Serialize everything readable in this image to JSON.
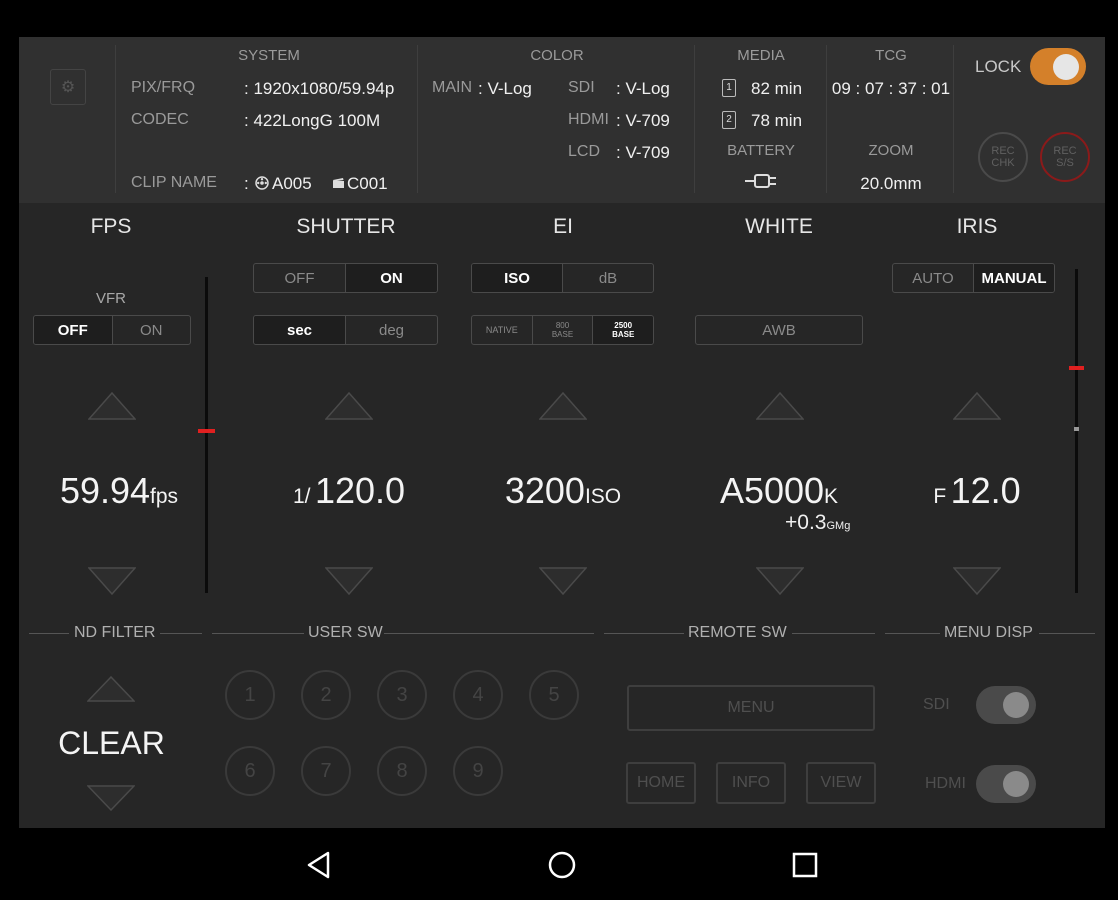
{
  "header": {
    "gear_icon": "gear-icon",
    "system": {
      "title": "SYSTEM",
      "pixfrq_label": "PIX/FRQ",
      "pixfrq_value": ": 1920x1080/59.94p",
      "codec_label": "CODEC",
      "codec_value": ": 422LongG 100M",
      "clip_label": "CLIP NAME",
      "clip_colon": ":",
      "clip_reel": "A005",
      "clip_num": "C001"
    },
    "color": {
      "title": "COLOR",
      "main_label": "MAIN",
      "main_value": ": V-Log",
      "sdi_label": "SDI",
      "sdi_value": ": V-Log",
      "hdmi_label": "HDMI",
      "hdmi_value": ": V-709",
      "lcd_label": "LCD",
      "lcd_value": ": V-709"
    },
    "media": {
      "title": "MEDIA",
      "slot1_num": "1",
      "slot1_value": "82 min",
      "slot2_num": "2",
      "slot2_value": "78 min",
      "battery_title": "BATTERY"
    },
    "tcg": {
      "title": "TCG",
      "value": "09 : 07 : 37 : 01",
      "zoom_title": "ZOOM",
      "zoom_value": "20.0mm"
    },
    "lock": {
      "label": "LOCK",
      "on": true
    },
    "rec_chk": {
      "line1": "REC",
      "line2": "CHK"
    },
    "rec_ss": {
      "line1": "REC",
      "line2": "S/S"
    }
  },
  "fps": {
    "title": "FPS",
    "vfr_label": "VFR",
    "vfr_off": "OFF",
    "vfr_on": "ON",
    "value": "59.94",
    "unit": "fps",
    "slider_level": 0.48
  },
  "shutter": {
    "title": "SHUTTER",
    "off": "OFF",
    "on": "ON",
    "sec": "sec",
    "deg": "deg",
    "prefix": "1/",
    "value": "120.0"
  },
  "ei": {
    "title": "EI",
    "iso": "ISO",
    "db": "dB",
    "native": "NATIVE",
    "b800_a": "800",
    "b800_b": "BASE",
    "b2500_a": "2500",
    "b2500_b": "BASE",
    "value": "3200",
    "unit": "ISO"
  },
  "white": {
    "title": "WHITE",
    "awb": "AWB",
    "value": "A5000",
    "unit": "K",
    "offset": "+0.3",
    "offset_unit": "GMg"
  },
  "iris": {
    "title": "IRIS",
    "auto": "AUTO",
    "manual": "MANUAL",
    "prefix": "F",
    "value": "12.0",
    "slider_level": 0.7
  },
  "nd_filter": {
    "title": "ND FILTER",
    "value": "CLEAR"
  },
  "user_sw": {
    "title": "USER SW",
    "buttons": [
      "1",
      "2",
      "3",
      "4",
      "5",
      "6",
      "7",
      "8",
      "9"
    ]
  },
  "remote_sw": {
    "title": "REMOTE SW",
    "menu": "MENU",
    "home": "HOME",
    "info": "INFO",
    "view": "VIEW"
  },
  "menu_disp": {
    "title": "MENU DISP",
    "sdi": "SDI",
    "hdmi": "HDMI"
  },
  "colors": {
    "accent_orange": "#d4802a",
    "rec_red": "#8b1a1a",
    "marker_red": "#e02020"
  }
}
